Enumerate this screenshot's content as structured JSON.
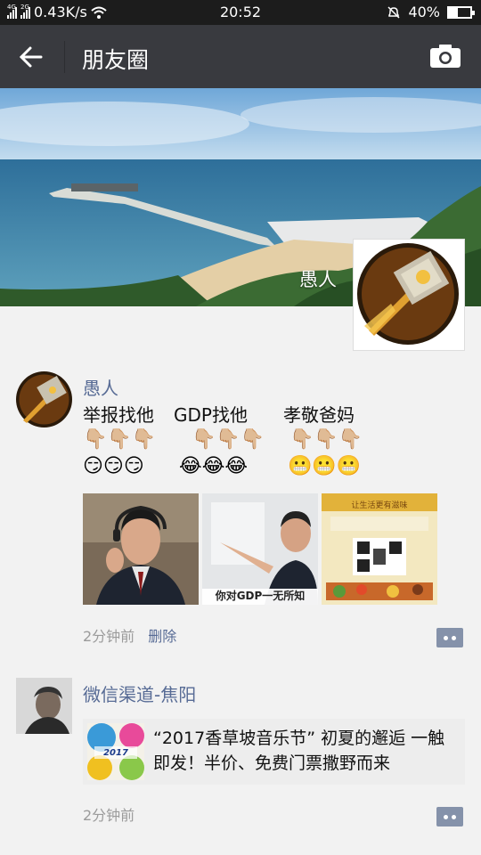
{
  "status_bar": {
    "signal1_tag": "4G",
    "signal2_tag": "2G",
    "speed": "0.43K/s",
    "time": "20:52",
    "battery": "40%",
    "battery_level": 0.4
  },
  "header": {
    "title": "朋友圈"
  },
  "cover": {
    "name": "愚人"
  },
  "posts": [
    {
      "username": "愚人",
      "text_parts": [
        "举报找他",
        "GDP找他",
        "孝敬爸妈"
      ],
      "pointing_row": [
        "👇🏼👇🏼👇🏼",
        "👇🏼👇🏼👇🏼",
        "👇🏼👇🏼👇🏼"
      ],
      "face_row": [
        "😏😏😏",
        "😂😂😂",
        "😬😬😬"
      ],
      "photo_captions": [
        "",
        "你对GDP一无所知",
        ""
      ],
      "poster_texts": [
        "让生活更有滋味"
      ],
      "time": "2分钟前",
      "delete_label": "删除"
    },
    {
      "username": "微信渠道-焦阳",
      "link_title": "“2017香草坡音乐节” 初夏的邂逅 一触即发！半价、免费门票撒野而来",
      "thumb_text": "2017",
      "time": "2分钟前"
    }
  ],
  "colors": {
    "link_blue": "#576b95",
    "title_bar": "#393a3f",
    "status_bar": "#1c1c1c"
  }
}
